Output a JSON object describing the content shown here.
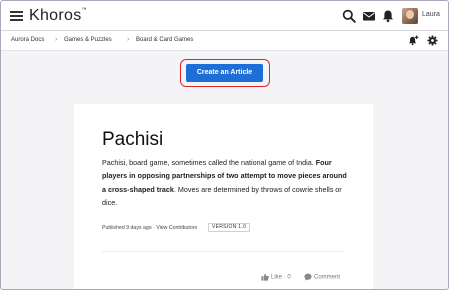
{
  "header": {
    "logo": "Khoros",
    "user_name": "Laura"
  },
  "breadcrumb": [
    {
      "label": "Aurora Docs"
    },
    {
      "label": "Games & Puzzles"
    },
    {
      "label": "Board & Card Games"
    }
  ],
  "actions": {
    "create_article_label": "Create an Article"
  },
  "article": {
    "title": "Pachisi",
    "body_intro": "Pachisi, board game, sometimes called the national game of India. ",
    "body_bold": "Four players in opposing partnerships of two attempt to move pieces around a cross-shaped track",
    "body_outro": ". Moves are determined by throws of cowrie shells or dice.",
    "published": "Published 9 days ago",
    "meta_separator": " · ",
    "view_contributors": "View Contributors",
    "version_badge": "VERSION 1.0",
    "like_label": "Like",
    "like_separator": " · ",
    "like_count": "0",
    "comment_label": "Comment"
  },
  "colors": {
    "accent": "#1d6fd7",
    "highlight_ring": "#e0242a",
    "background": "#f4f4f6"
  },
  "icons": {
    "menu": "hamburger-icon",
    "search": "search-icon",
    "messages": "envelope-icon",
    "notifications": "bell-icon",
    "subscribe": "bell-plus-icon",
    "settings": "gear-icon",
    "like": "thumbs-up-icon",
    "comment": "speech-bubble-icon",
    "breadcrumb_separator": "chevron-right-icon"
  }
}
